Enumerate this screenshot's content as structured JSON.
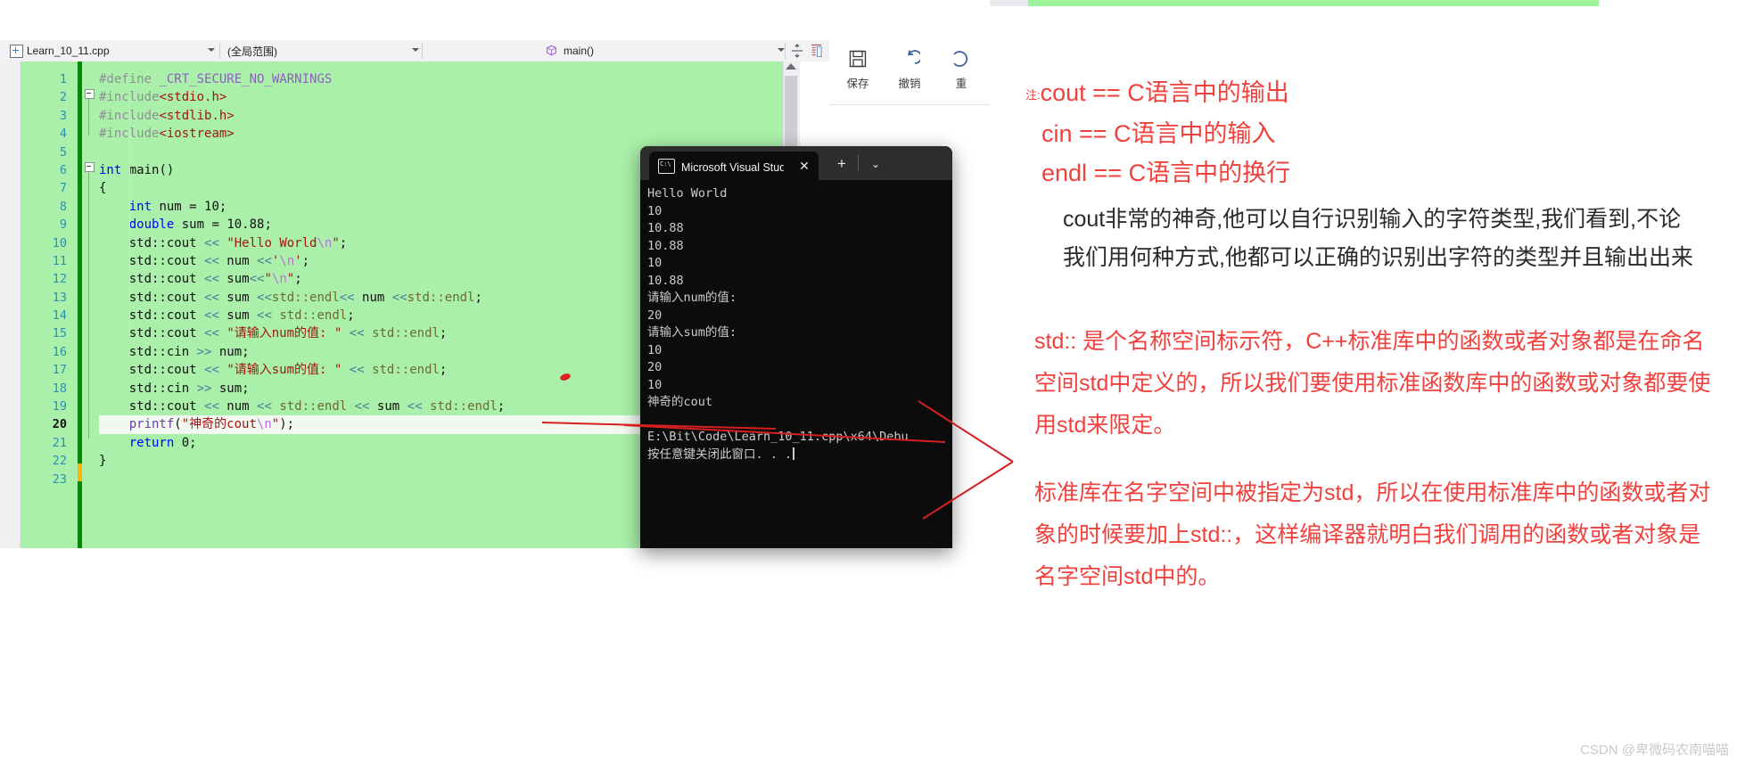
{
  "ide": {
    "file_tab": "Learn_10_11.cpp",
    "scope_dropdown": "(全局范围)",
    "member_dropdown": "main()",
    "toolbar": [
      {
        "label": "保存",
        "icon": "save-icon"
      },
      {
        "label": "撤销",
        "icon": "undo-icon"
      },
      {
        "label": "重",
        "icon": "redo-icon"
      }
    ],
    "code": {
      "line_numbers": [
        "1",
        "2",
        "3",
        "4",
        "5",
        "6",
        "7",
        "8",
        "9",
        "10",
        "11",
        "12",
        "13",
        "14",
        "15",
        "16",
        "17",
        "18",
        "19",
        "20",
        "21",
        "22",
        "23"
      ],
      "current_line": "20",
      "lines": [
        "#define _CRT_SECURE_NO_WARNINGS",
        "#include<stdio.h>",
        "#include<stdlib.h>",
        "#include<iostream>",
        "",
        "int main()",
        "{",
        "    int num = 10;",
        "    double sum = 10.88;",
        "    std::cout << \"Hello World\\n\";",
        "    std::cout << num <<'\\n';",
        "    std::cout << sum<<\"\\n\";",
        "    std::cout << sum <<std::endl<< num <<std::endl;",
        "    std::cout << sum << std::endl;",
        "    std::cout << \"请输入num的值: \" << std::endl;",
        "    std::cin >> num;",
        "    std::cout << \"请输入sum的值: \" << std::endl;",
        "    std::cin >> sum;",
        "    std::cout << num << std::endl << sum << std::endl;",
        "    printf(\"神奇的cout\\n\");",
        "    return 0;",
        "}",
        ""
      ]
    }
  },
  "console": {
    "tab_title": "Microsoft Visual Studio 调试控",
    "close_label": "✕",
    "newtab_label": "+",
    "chevron_label": "⌄",
    "output": [
      "Hello World",
      "10",
      "10.88",
      "10.88",
      "10",
      "10.88",
      "请输入num的值:",
      "20",
      "请输入sum的值:",
      "10",
      "20",
      "10",
      "神奇的cout",
      "",
      "E:\\Bit\\Code\\Learn_10_11.cpp\\x64\\Debu",
      "按任意键关闭此窗口. . ."
    ]
  },
  "notes": {
    "prefix": "注:",
    "line1": "cout == C语言中的输出",
    "line2": "cin    == C语言中的输入",
    "line3": "endl  == C语言中的换行",
    "paragraph_black": "cout非常的神奇,他可以自行识别输入的字符类型,我们看到,不论我们用何种方式,他都可以正确的识别出字符的类型并且输出出来",
    "paragraph_red_1": "std:: 是个名称空间标示符，C++标准库中的函数或者对象都是在命名空间std中定义的，所以我们要使用标准函数库中的函数或对象都要使用std来限定。",
    "paragraph_red_2": "标准库在名字空间中被指定为std，所以在使用标准库中的函数或者对象的时候要加上std::，这样编译器就明白我们调用的函数或者对象是名字空间std中的。"
  },
  "watermark": "CSDN @卑微码农南喵喵",
  "colors": {
    "annotation_red": "#f2403c",
    "editor_background": "#aaf0aa",
    "console_background": "#0c0c0c",
    "change_bar_green": "#008a00",
    "change_bar_orange": "#ffb400"
  }
}
